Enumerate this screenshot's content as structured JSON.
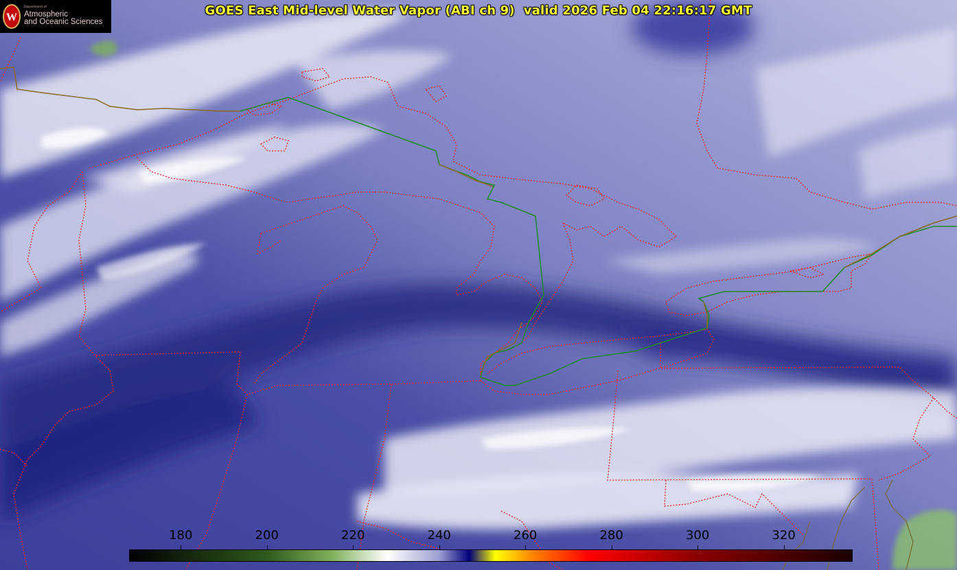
{
  "title": "GOES East Mid-level Water Vapor (ABI ch 9)  valid 2026 Feb 04 22:16:17 GMT",
  "logo": {
    "dept": "Department of",
    "line1": "Atmospheric",
    "line2": "and Oceanic Sciences",
    "shield_letter": "W"
  },
  "colorbar": {
    "min": 168,
    "max": 336,
    "ticks": [
      {
        "value": 180,
        "label": "180"
      },
      {
        "value": 200,
        "label": "200"
      },
      {
        "value": 220,
        "label": "220"
      },
      {
        "value": 240,
        "label": "240"
      },
      {
        "value": 260,
        "label": "260"
      },
      {
        "value": 280,
        "label": "280"
      },
      {
        "value": 300,
        "label": "300"
      },
      {
        "value": 320,
        "label": "320"
      }
    ],
    "stops": [
      {
        "value": 168,
        "color": "#000000"
      },
      {
        "value": 200,
        "color": "#2f5a1c"
      },
      {
        "value": 215,
        "color": "#7fb05c"
      },
      {
        "value": 228,
        "color": "#ffffff"
      },
      {
        "value": 240,
        "color": "#9c9fd1"
      },
      {
        "value": 247,
        "color": "#00007a"
      },
      {
        "value": 253,
        "color": "#ffff00"
      },
      {
        "value": 262,
        "color": "#ff8000"
      },
      {
        "value": 275,
        "color": "#ff0000"
      },
      {
        "value": 300,
        "color": "#8b0000"
      },
      {
        "value": 336,
        "color": "#1a0000"
      }
    ]
  },
  "colors": {
    "state_border": "#ff2222",
    "country_border": "#1f8a1f",
    "coast": "#8a6a1f"
  }
}
